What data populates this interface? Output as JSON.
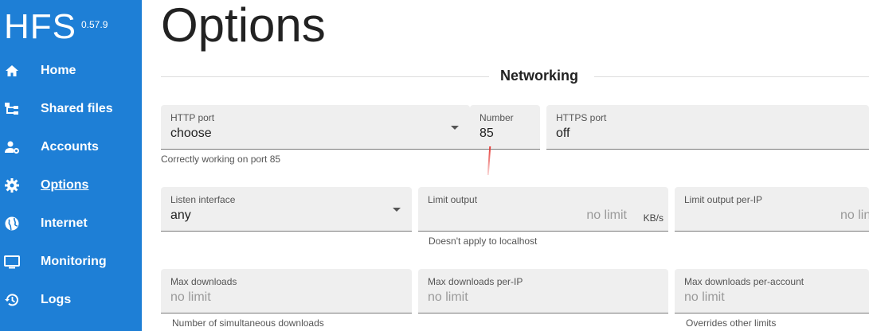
{
  "app": {
    "name": "HFS",
    "version": "0.57.9"
  },
  "nav": [
    {
      "label": "Home",
      "icon": "home-icon"
    },
    {
      "label": "Shared files",
      "icon": "tree-icon"
    },
    {
      "label": "Accounts",
      "icon": "accounts-icon"
    },
    {
      "label": "Options",
      "icon": "gear-icon",
      "active": true
    },
    {
      "label": "Internet",
      "icon": "globe-icon"
    },
    {
      "label": "Monitoring",
      "icon": "monitor-icon"
    },
    {
      "label": "Logs",
      "icon": "history-icon"
    }
  ],
  "page": {
    "title": "Options",
    "section": "Networking"
  },
  "fields": {
    "http_port": {
      "label": "HTTP port",
      "value": "choose",
      "helper": "Correctly working on port 85"
    },
    "number": {
      "label": "Number",
      "value": "85"
    },
    "https_port": {
      "label": "HTTPS port",
      "value": "off"
    },
    "listen_interface": {
      "label": "Listen interface",
      "value": "any"
    },
    "limit_output": {
      "label": "Limit output",
      "placeholder": "no limit",
      "unit": "KB/s",
      "helper": "Doesn't apply to localhost"
    },
    "limit_output_ip": {
      "label": "Limit output per-IP",
      "placeholder": "no lin"
    },
    "max_downloads": {
      "label": "Max downloads",
      "placeholder": "no limit",
      "helper": "Number of simultaneous downloads"
    },
    "max_downloads_ip": {
      "label": "Max downloads per-IP",
      "placeholder": "no limit"
    },
    "max_downloads_account": {
      "label": "Max downloads per-account",
      "placeholder": "no limit",
      "helper": "Overrides other limits"
    }
  },
  "colors": {
    "sidebar": "#1e7fd6",
    "field_bg": "#efefef",
    "marker": "#e53935"
  }
}
